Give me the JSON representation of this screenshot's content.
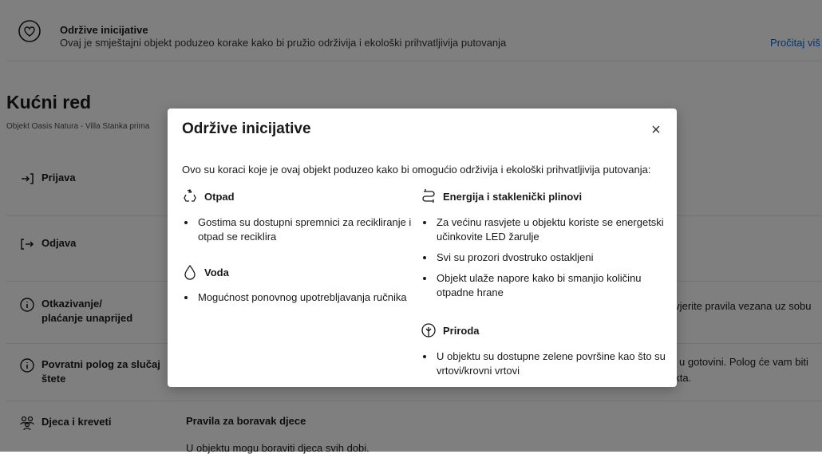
{
  "banner": {
    "title": "Održive inicijative",
    "text": "Ovaj je smještajni objekt poduzeo korake kako bi pružio održivija i ekološki prihvatljivija putovanja",
    "link": "Pročitaj viš"
  },
  "house_rules": {
    "title": "Kućni red",
    "subtitle": "Objekt Oasis Natura - Villa Stanka prima",
    "rows": [
      {
        "label": "Prijava",
        "right": ""
      },
      {
        "label": "Odjava",
        "right": ""
      },
      {
        "label_line1": "Otkazivanje/",
        "label_line2": "plaćanje unaprijed",
        "right": "ovjerite pravila vezana uz sobu"
      },
      {
        "label_line1": "Povratni polog za slučaj",
        "label_line2": "štete",
        "right_line1": "iti u gotovini. Polog će vam biti",
        "right_line2": "ekta."
      },
      {
        "label": "Djeca i kreveti",
        "right": ""
      }
    ],
    "kids_title": "Pravila za boravak djece",
    "kids_text": "U objektu mogu boraviti djeca svih dobi."
  },
  "modal": {
    "title": "Održive inicijative",
    "close_label": "×",
    "intro": "Ovo su koraci koje je ovaj objekt poduzeo kako bi omogućio održivija i ekološki prihvatljivija putovanja:",
    "sections": [
      {
        "title": "Otpad",
        "icon": "recycle-icon",
        "items": [
          "Gostima su dostupni spremnici za recikliranje i otpad se reciklira"
        ]
      },
      {
        "title": "Voda",
        "icon": "water-drop-icon",
        "items": [
          "Mogućnost ponovnog upotrebljavanja ručnika"
        ]
      },
      {
        "title": "Energija i staklenički plinovi",
        "icon": "energy-icon",
        "items": [
          "Za većinu rasvjete u objektu koriste se energetski učinkovite LED žarulje",
          "Svi su prozori dvostruko ostakljeni",
          "Objekt ulaže napore kako bi smanjio količinu otpadne hrane"
        ]
      },
      {
        "title": "Priroda",
        "icon": "leaf-icon",
        "items": [
          "U objektu su dostupne zelene površine kao što su vrtovi/krovni vrtovi"
        ]
      }
    ]
  },
  "colors": {
    "link": "#006ce4",
    "overlay": "rgba(0,0,0,0.5)"
  }
}
